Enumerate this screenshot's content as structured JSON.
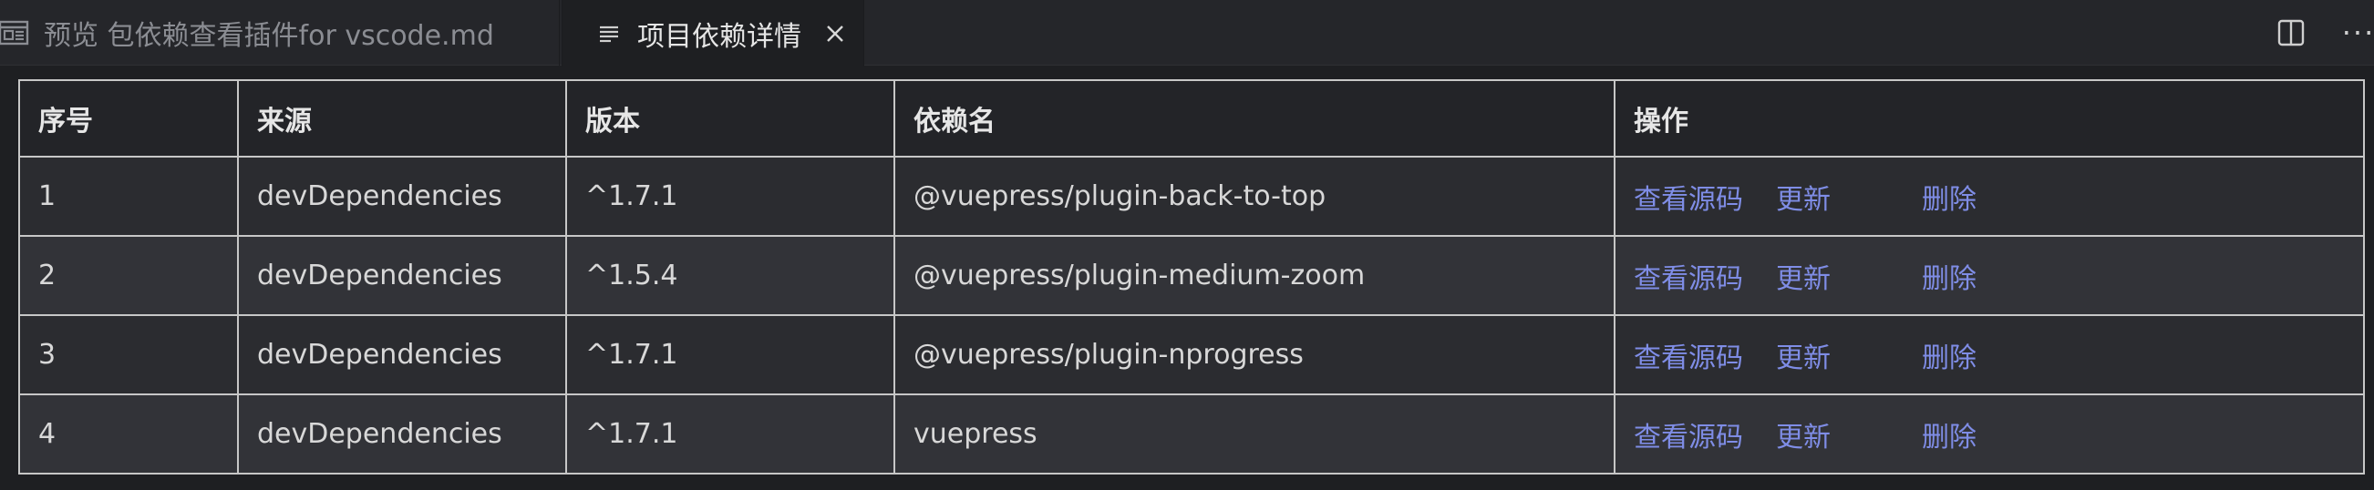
{
  "tabs": [
    {
      "label": "预览 包依赖查看插件for vscode.md",
      "active": false,
      "icon": "preview-icon"
    },
    {
      "label": "项目依赖详情",
      "active": true,
      "icon": "lines-icon"
    }
  ],
  "actions": {
    "split_icon": "split-editor-icon",
    "more_label": "···"
  },
  "table": {
    "headers": [
      "序号",
      "来源",
      "版本",
      "依赖名",
      "操作"
    ],
    "rows": [
      {
        "index": "1",
        "source": "devDependencies",
        "version": "^1.7.1",
        "name": "@vuepress/plugin-back-to-top"
      },
      {
        "index": "2",
        "source": "devDependencies",
        "version": "^1.5.4",
        "name": "@vuepress/plugin-medium-zoom"
      },
      {
        "index": "3",
        "source": "devDependencies",
        "version": "^1.7.1",
        "name": "@vuepress/plugin-nprogress"
      },
      {
        "index": "4",
        "source": "devDependencies",
        "version": "^1.7.1",
        "name": "vuepress"
      }
    ],
    "ops": {
      "view_source": "查看源码",
      "update": "更新",
      "delete": "删除"
    }
  },
  "colors": {
    "background": "#1e1f22",
    "link": "#7f8de6",
    "border": "#c7c7c7",
    "row_odd": "#2b2c30",
    "row_even": "#323338"
  }
}
